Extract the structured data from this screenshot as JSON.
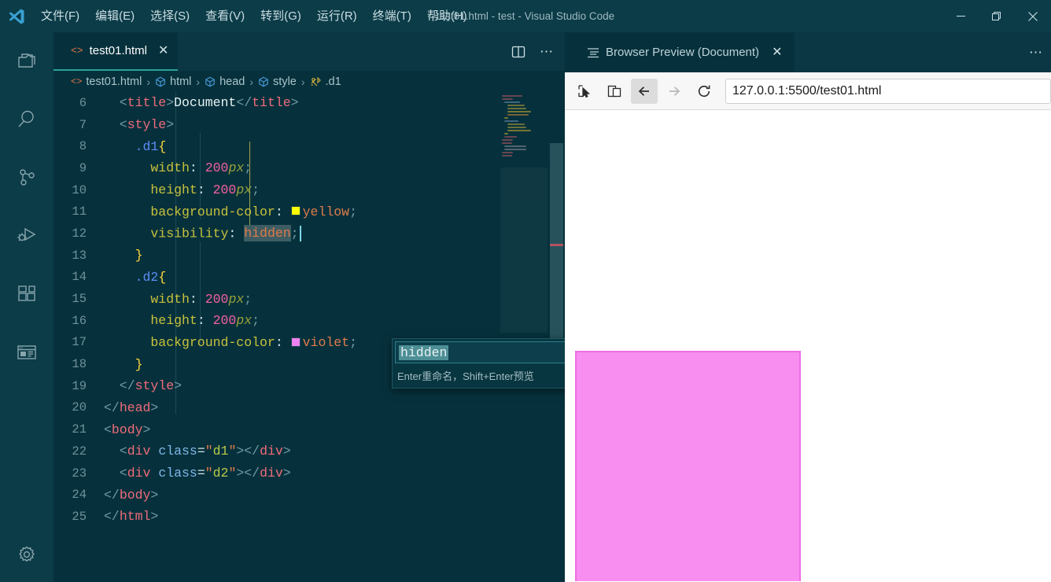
{
  "window": {
    "title": "test01.html - test - Visual Studio Code",
    "logo_icon": "vscode-logo-icon",
    "minimize_label": "–",
    "restore_label": "❐",
    "close_label": "✕"
  },
  "menubar": {
    "items": [
      {
        "label": "文件(F)",
        "name": "menu-file"
      },
      {
        "label": "编辑(E)",
        "name": "menu-edit"
      },
      {
        "label": "选择(S)",
        "name": "menu-selection"
      },
      {
        "label": "查看(V)",
        "name": "menu-view"
      },
      {
        "label": "转到(G)",
        "name": "menu-go"
      },
      {
        "label": "运行(R)",
        "name": "menu-run"
      },
      {
        "label": "终端(T)",
        "name": "menu-terminal"
      },
      {
        "label": "帮助(H)",
        "name": "menu-help"
      }
    ]
  },
  "activitybar": {
    "items": [
      {
        "icon": "files-explorer-icon",
        "label": "Explorer"
      },
      {
        "icon": "search-icon",
        "label": "Search"
      },
      {
        "icon": "source-control-icon",
        "label": "Source Control"
      },
      {
        "icon": "run-and-debug-icon",
        "label": "Run and Debug"
      },
      {
        "icon": "extensions-icon",
        "label": "Extensions"
      },
      {
        "icon": "browser-preview-icon",
        "label": "Browser Preview"
      }
    ],
    "bottom": [
      {
        "icon": "gear-icon",
        "label": "Manage"
      }
    ]
  },
  "editor": {
    "tab": {
      "label": "test01.html",
      "icon": "html-file-icon",
      "close_label": "✕"
    },
    "actions": {
      "split_label": "split-editor-icon",
      "more_label": "⋯"
    },
    "breadcrumb": [
      {
        "label": "test01.html",
        "icon": "html-file-icon"
      },
      {
        "label": "html",
        "icon": "symbol-field-icon"
      },
      {
        "label": "head",
        "icon": "symbol-field-icon"
      },
      {
        "label": "style",
        "icon": "symbol-field-icon"
      },
      {
        "label": ".d1",
        "icon": "symbol-ruler-icon"
      }
    ],
    "breadcrumb_separator": "›",
    "first_line_number": 6,
    "lines": [
      {
        "no": 6,
        "indent": 2,
        "tokens": [
          {
            "t": "punc",
            "v": "<"
          },
          {
            "t": "tag",
            "v": "title"
          },
          {
            "t": "punc",
            "v": ">"
          },
          {
            "t": "text",
            "v": "Document"
          },
          {
            "t": "punc",
            "v": "</"
          },
          {
            "t": "tag",
            "v": "title"
          },
          {
            "t": "punc",
            "v": ">"
          }
        ]
      },
      {
        "no": 7,
        "indent": 2,
        "tokens": [
          {
            "t": "punc",
            "v": "<"
          },
          {
            "t": "tag",
            "v": "style"
          },
          {
            "t": "punc",
            "v": ">"
          }
        ]
      },
      {
        "no": 8,
        "indent": 4,
        "tokens": [
          {
            "t": "sel",
            "v": ".d1"
          },
          {
            "t": "brace",
            "v": "{"
          }
        ]
      },
      {
        "no": 9,
        "indent": 6,
        "tokens": [
          {
            "t": "prop",
            "v": "width"
          },
          {
            "t": "eq",
            "v": ": "
          },
          {
            "t": "num",
            "v": "200"
          },
          {
            "t": "unit",
            "v": "px"
          },
          {
            "t": "punc",
            "v": ";"
          }
        ]
      },
      {
        "no": 10,
        "indent": 6,
        "tokens": [
          {
            "t": "prop",
            "v": "height"
          },
          {
            "t": "eq",
            "v": ": "
          },
          {
            "t": "num",
            "v": "200"
          },
          {
            "t": "unit",
            "v": "px"
          },
          {
            "t": "punc",
            "v": ";"
          }
        ]
      },
      {
        "no": 11,
        "indent": 6,
        "tokens": [
          {
            "t": "prop",
            "v": "background-color"
          },
          {
            "t": "eq",
            "v": ": "
          },
          {
            "t": "swatch",
            "v": "#ffff00"
          },
          {
            "t": "val",
            "v": "yellow"
          },
          {
            "t": "punc",
            "v": ";"
          }
        ]
      },
      {
        "no": 12,
        "indent": 6,
        "tokens": [
          {
            "t": "prop",
            "v": "visibility"
          },
          {
            "t": "eq",
            "v": ": "
          },
          {
            "t": "sel-hl-val",
            "v": "hidden"
          },
          {
            "t": "punc",
            "v": ";"
          },
          {
            "t": "cursor",
            "v": ""
          }
        ]
      },
      {
        "no": 13,
        "indent": 4,
        "tokens": [
          {
            "t": "brace",
            "v": "}"
          }
        ]
      },
      {
        "no": 14,
        "indent": 4,
        "tokens": [
          {
            "t": "sel",
            "v": ".d2"
          },
          {
            "t": "brace",
            "v": "{"
          }
        ]
      },
      {
        "no": 15,
        "indent": 6,
        "tokens": [
          {
            "t": "prop",
            "v": "width"
          },
          {
            "t": "eq",
            "v": ": "
          },
          {
            "t": "num",
            "v": "200"
          },
          {
            "t": "unit",
            "v": "px"
          },
          {
            "t": "punc",
            "v": ";"
          }
        ]
      },
      {
        "no": 16,
        "indent": 6,
        "tokens": [
          {
            "t": "prop",
            "v": "height"
          },
          {
            "t": "eq",
            "v": ": "
          },
          {
            "t": "num",
            "v": "200"
          },
          {
            "t": "unit",
            "v": "px"
          },
          {
            "t": "punc",
            "v": ";"
          }
        ]
      },
      {
        "no": 17,
        "indent": 6,
        "tokens": [
          {
            "t": "prop",
            "v": "background-color"
          },
          {
            "t": "eq",
            "v": ": "
          },
          {
            "t": "swatch",
            "v": "#ee82ee"
          },
          {
            "t": "val",
            "v": "violet"
          },
          {
            "t": "punc",
            "v": ";"
          }
        ]
      },
      {
        "no": 18,
        "indent": 4,
        "tokens": [
          {
            "t": "brace",
            "v": "}"
          }
        ]
      },
      {
        "no": 19,
        "indent": 2,
        "tokens": [
          {
            "t": "punc",
            "v": "</"
          },
          {
            "t": "tag",
            "v": "style"
          },
          {
            "t": "punc",
            "v": ">"
          }
        ]
      },
      {
        "no": 20,
        "indent": 0,
        "tokens": [
          {
            "t": "punc",
            "v": "</"
          },
          {
            "t": "tag",
            "v": "head"
          },
          {
            "t": "punc",
            "v": ">"
          }
        ]
      },
      {
        "no": 21,
        "indent": 0,
        "tokens": [
          {
            "t": "punc",
            "v": "<"
          },
          {
            "t": "tag",
            "v": "body"
          },
          {
            "t": "punc",
            "v": ">"
          }
        ]
      },
      {
        "no": 22,
        "indent": 2,
        "tokens": [
          {
            "t": "punc",
            "v": "<"
          },
          {
            "t": "tag",
            "v": "div"
          },
          {
            "t": "eq",
            "v": " "
          },
          {
            "t": "attr",
            "v": "class"
          },
          {
            "t": "eq",
            "v": "="
          },
          {
            "t": "quote",
            "v": "\""
          },
          {
            "t": "str",
            "v": "d1"
          },
          {
            "t": "quote",
            "v": "\""
          },
          {
            "t": "punc",
            "v": "></"
          },
          {
            "t": "tag",
            "v": "div"
          },
          {
            "t": "punc",
            "v": ">"
          }
        ]
      },
      {
        "no": 23,
        "indent": 2,
        "tokens": [
          {
            "t": "punc",
            "v": "<"
          },
          {
            "t": "tag",
            "v": "div"
          },
          {
            "t": "eq",
            "v": " "
          },
          {
            "t": "attr",
            "v": "class"
          },
          {
            "t": "eq",
            "v": "="
          },
          {
            "t": "quote",
            "v": "\""
          },
          {
            "t": "str",
            "v": "d2"
          },
          {
            "t": "quote",
            "v": "\""
          },
          {
            "t": "punc",
            "v": "></"
          },
          {
            "t": "tag",
            "v": "div"
          },
          {
            "t": "punc",
            "v": ">"
          }
        ]
      },
      {
        "no": 24,
        "indent": 0,
        "tokens": [
          {
            "t": "punc",
            "v": "</"
          },
          {
            "t": "tag",
            "v": "body"
          },
          {
            "t": "punc",
            "v": ">"
          }
        ]
      },
      {
        "no": 25,
        "indent": 0,
        "tokens": [
          {
            "t": "punc",
            "v": "</"
          },
          {
            "t": "tag",
            "v": "html"
          },
          {
            "t": "punc",
            "v": ">"
          }
        ]
      }
    ]
  },
  "rename_widget": {
    "value": "hidden",
    "hint": "Enter重命名，Shift+Enter预览"
  },
  "preview_panel": {
    "tab": {
      "label": "Browser Preview (Document)",
      "icon": "list-icon",
      "close_label": "✕"
    },
    "more_label": "⋯",
    "toolbar": {
      "inspect_icon": "cursor-select-icon",
      "device_icon": "device-toggle-icon",
      "back_icon": "arrow-left-icon",
      "forward_icon": "arrow-right-icon",
      "reload_icon": "reload-icon",
      "url": "127.0.0.1:5500/test01.html",
      "url_placeholder": "Enter address"
    },
    "rendered": {
      "d1_visible": false,
      "d1_color": "#ffff00",
      "d2_color": "#f78ef0",
      "d2_border_color": "#ef6fe4"
    }
  },
  "colors": {
    "titlebar_bg": "#0b3c48",
    "editor_bg": "#06313c",
    "accent": "#2aa198",
    "browser_chrome": "#f7f7f7"
  }
}
